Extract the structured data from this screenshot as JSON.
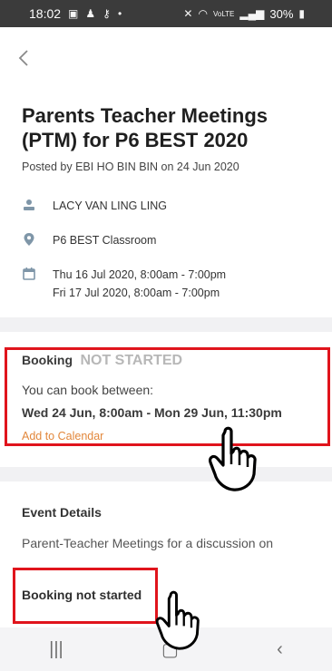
{
  "status_bar": {
    "time": "18:02",
    "battery": "30%",
    "icons": [
      "image-icon",
      "figure-icon",
      "key-icon",
      "dot-icon",
      "mute-icon",
      "wifi-icon",
      "volte-icon",
      "signal-icon",
      "battery-icon"
    ]
  },
  "header": {
    "back_icon": "chevron-left-icon"
  },
  "event": {
    "title": "Parents Teacher Meetings (PTM) for P6 BEST 2020",
    "posted": "Posted by EBI HO BIN BIN on 24 Jun 2020",
    "teacher": "LACY VAN LING LING",
    "location": "P6 BEST Classroom",
    "dates": [
      "Thu 16 Jul 2020, 8:00am - 7:00pm",
      "Fri 17 Jul 2020, 8:00am - 7:00pm"
    ]
  },
  "booking": {
    "label": "Booking",
    "status": "NOT STARTED",
    "intro": "You can book between:",
    "range": "Wed 24 Jun, 8:00am - Mon 29 Jun, 11:30pm",
    "calendar_link": "Add to Calendar"
  },
  "details": {
    "title": "Event Details",
    "text": "Parent-Teacher Meetings for a discussion on"
  },
  "footer": {
    "not_started": "Booking not started"
  },
  "nav": {
    "icons": [
      "recent-apps-icon",
      "home-icon",
      "back-icon"
    ]
  },
  "colors": {
    "highlight": "#e0141c",
    "link": "#e2873b",
    "icon": "#7f96a8"
  }
}
